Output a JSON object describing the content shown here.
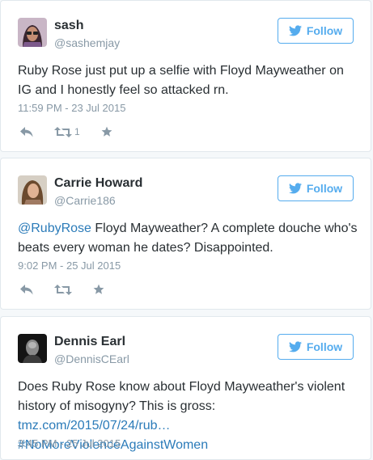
{
  "follow_label": "Follow",
  "tweets": [
    {
      "name": "sash",
      "handle": "@sashemjay",
      "text": "Ruby Rose just put up a selfie with Floyd Mayweather on IG and I honestly feel so attacked rn.",
      "time": "11:59 PM - 23 Jul 2015",
      "retweet_count": "1"
    },
    {
      "name": "Carrie Howard",
      "handle": "@Carrie186",
      "mention": "@RubyRose",
      "text_after": " Floyd Mayweather? A complete douche who's beats every woman he dates? Disappointed.",
      "time": "9:02 PM - 25 Jul 2015"
    },
    {
      "name": "Dennis Earl",
      "handle": "@DennisCEarl",
      "text_before": "Does Ruby Rose know about Floyd Mayweather's violent history of misogyny? This is gross: ",
      "link": "tmz.com/2015/07/24/rub…",
      "space": " ",
      "hashtag": "#NoMoreViolenceAgainstWomen",
      "time": "3:45 PM - 25 Jul 2015"
    }
  ],
  "colors": {
    "accent": "#55acee",
    "link": "#2b7bb9",
    "muted": "#8899a6",
    "text": "#292f33",
    "border": "#e1e8ed"
  },
  "icons": {
    "follow": "twitter-bird-icon",
    "reply": "reply-icon",
    "retweet": "retweet-icon",
    "favorite": "star-icon"
  }
}
